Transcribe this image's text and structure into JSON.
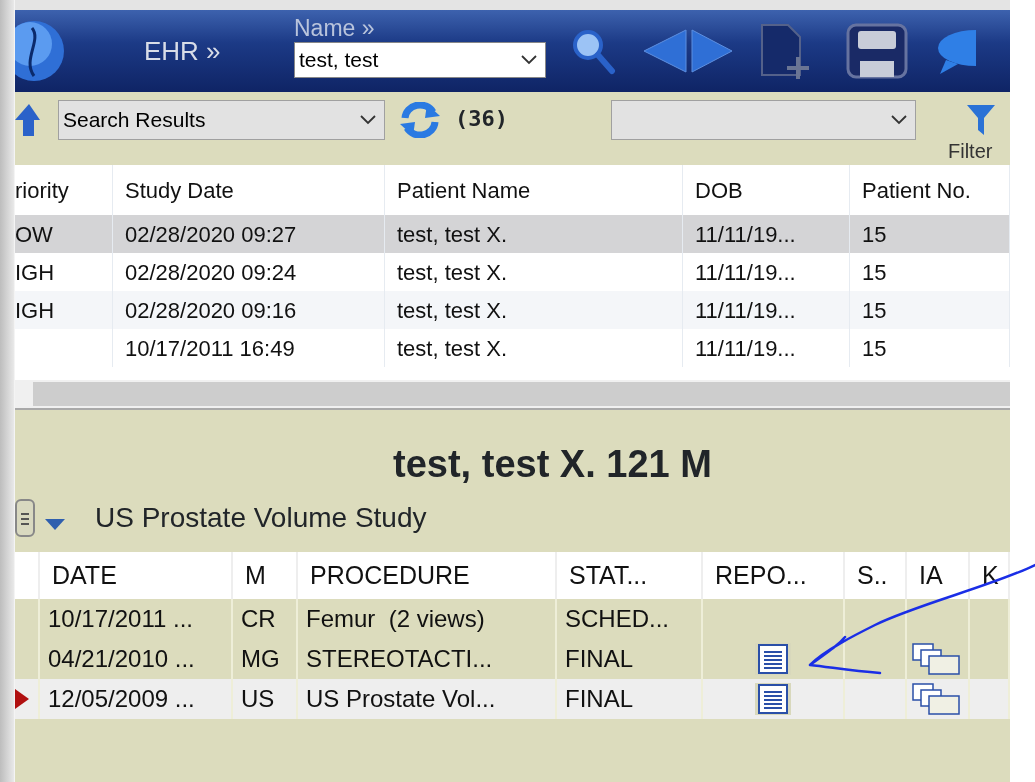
{
  "header": {
    "ehr_link": "EHR »",
    "name_label": "Name »",
    "name_value": "test, test"
  },
  "toolbar": {
    "view_select": "Search Results",
    "count": "(36)",
    "filter_label": "Filter"
  },
  "results_table": {
    "columns": [
      "riority",
      "Study Date",
      "Patient Name",
      "DOB",
      "Patient No."
    ],
    "rows": [
      {
        "cells": [
          "OW",
          "02/28/2020 09:27",
          "test, test X.",
          "11/11/19...",
          "15"
        ],
        "selected": true
      },
      {
        "cells": [
          "IGH",
          "02/28/2020 09:24",
          "test, test X.",
          "11/11/19...",
          "15"
        ],
        "selected": false
      },
      {
        "cells": [
          "IGH",
          "02/28/2020 09:16",
          "test, test X.",
          "11/11/19...",
          "15"
        ],
        "selected": false
      },
      {
        "cells": [
          "",
          "10/17/2011 16:49",
          "test, test X.",
          "11/11/19...",
          "15"
        ],
        "selected": false
      }
    ]
  },
  "patient_title": "test, test X. 121 M",
  "study_title": "US Prostate Volume Study",
  "studies_table": {
    "columns": [
      "DATE",
      "M",
      "PROCEDURE",
      "STAT...",
      "REPO...",
      "S..",
      "IA",
      "K"
    ],
    "rows": [
      {
        "date": "10/17/2011 ...",
        "modality": "CR",
        "procedure": "Femur  (2 views)",
        "status": "SCHED...",
        "has_report": false,
        "has_images": false,
        "selected": false
      },
      {
        "date": "04/21/2010 ...",
        "modality": "MG",
        "procedure": "STEREOTACTI...",
        "status": "FINAL",
        "has_report": true,
        "has_images": true,
        "selected": false
      },
      {
        "date": "12/05/2009 ...",
        "modality": "US",
        "procedure": "US Prostate Vol...",
        "status": "FINAL",
        "has_report": true,
        "has_images": true,
        "selected": true
      }
    ]
  }
}
